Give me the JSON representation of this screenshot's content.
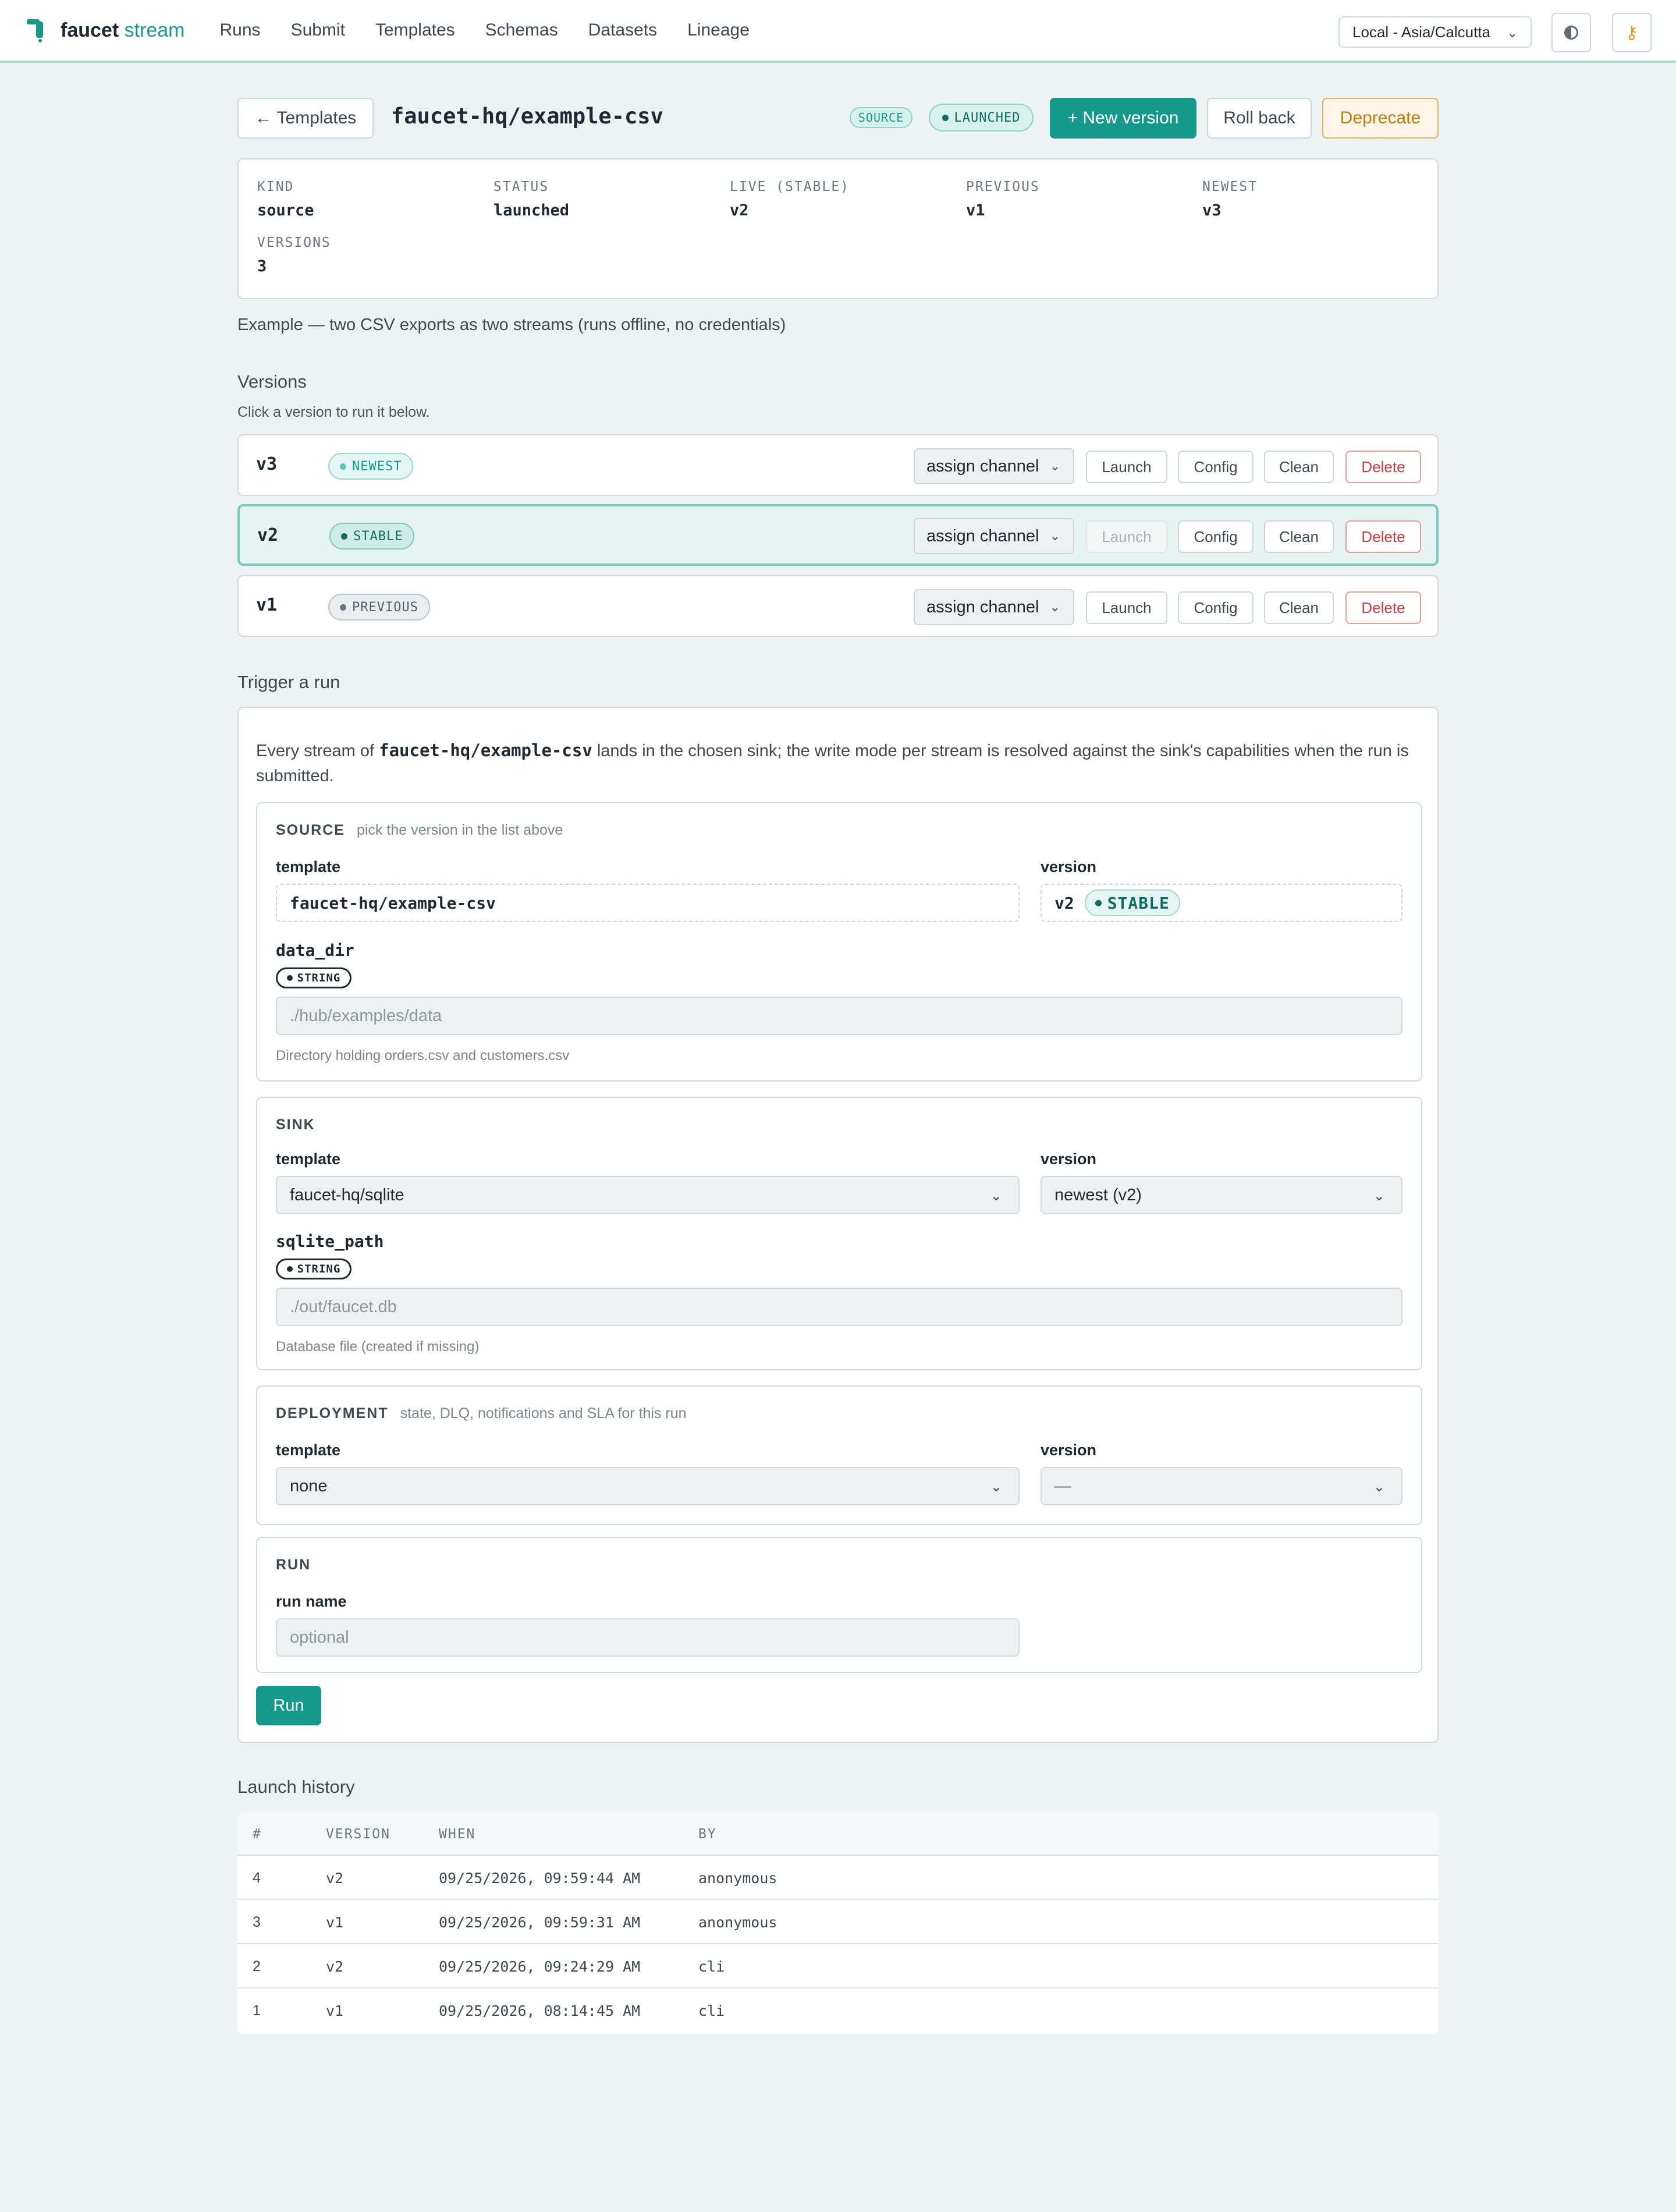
{
  "nav": {
    "brand_main": "faucet",
    "brand_accent": "stream",
    "links": [
      "Runs",
      "Submit",
      "Templates",
      "Schemas",
      "Datasets",
      "Lineage"
    ],
    "timezone": "Local - Asia/Calcutta",
    "theme_icon": "contrast-icon",
    "key_icon": "key-icon"
  },
  "header": {
    "back_label": "← Templates",
    "title": "faucet-hq/example-csv",
    "kind_tag": "SOURCE",
    "status_tag": "LAUNCHED",
    "new_version": "+ New version",
    "roll_back": "Roll back",
    "deprecate": "Deprecate"
  },
  "summary": {
    "stats": [
      {
        "label": "KIND",
        "value": "source"
      },
      {
        "label": "STATUS",
        "value": "launched"
      },
      {
        "label": "LIVE (STABLE)",
        "value": "v2"
      },
      {
        "label": "PREVIOUS",
        "value": "v1"
      },
      {
        "label": "NEWEST",
        "value": "v3"
      },
      {
        "label": "VERSIONS",
        "value": "3"
      }
    ],
    "description": "Example — two CSV exports as two streams (runs offline, no credentials)"
  },
  "versions": {
    "title": "Versions",
    "subtitle": "Click a version to run it below.",
    "rows": [
      {
        "name": "v3",
        "tag": "NEWEST",
        "channel": "assign channel",
        "launch": "Launch",
        "config": "Config",
        "clean": "Clean",
        "delete": "Delete"
      },
      {
        "name": "v2",
        "tag": "STABLE",
        "channel": "assign channel",
        "launch": "Launch",
        "config": "Config",
        "clean": "Clean",
        "delete": "Delete"
      },
      {
        "name": "v1",
        "tag": "PREVIOUS",
        "channel": "assign channel",
        "launch": "Launch",
        "config": "Config",
        "clean": "Clean",
        "delete": "Delete"
      }
    ]
  },
  "trigger": {
    "title": "Trigger a run",
    "intro_before": "Every stream of ",
    "intro_code": "faucet-hq/example-csv",
    "intro_after": " lands in the chosen sink; the write mode per stream is resolved against the sink's capabilities when the run is submitted.",
    "source": {
      "heading": "SOURCE",
      "hint": "pick the version in the list above",
      "template_label": "template",
      "template_value": "faucet-hq/example-csv",
      "version_label": "version",
      "version_value": "v2",
      "version_tag": "STABLE",
      "field_name": "data_dir",
      "field_type": "STRING",
      "field_placeholder": "./hub/examples/data",
      "field_help": "Directory holding orders.csv and customers.csv"
    },
    "sink": {
      "heading": "SINK",
      "template_label": "template",
      "template_value": "faucet-hq/sqlite",
      "version_label": "version",
      "version_value": "newest (v2)",
      "field_name": "sqlite_path",
      "field_type": "STRING",
      "field_placeholder": "./out/faucet.db",
      "field_help": "Database file (created if missing)"
    },
    "deployment": {
      "heading": "DEPLOYMENT",
      "hint": "state, DLQ, notifications and SLA for this run",
      "template_label": "template",
      "template_value": "none",
      "version_label": "version",
      "version_value": "—"
    },
    "run": {
      "heading": "RUN",
      "name_label": "run name",
      "name_placeholder": "optional",
      "button": "Run"
    }
  },
  "history": {
    "title": "Launch history",
    "columns": [
      "#",
      "VERSION",
      "WHEN",
      "BY"
    ],
    "rows": [
      [
        "4",
        "v2",
        "09/25/2026, 09:59:44 AM",
        "anonymous"
      ],
      [
        "3",
        "v1",
        "09/25/2026, 09:59:31 AM",
        "anonymous"
      ],
      [
        "2",
        "v2",
        "09/25/2026, 09:24:29 AM",
        "cli"
      ],
      [
        "1",
        "v1",
        "09/25/2026, 08:14:45 AM",
        "cli"
      ]
    ]
  },
  "colors": {
    "accent": "#14998a",
    "danger": "#d63a3a",
    "warning": "#c47d0d",
    "background": "#edf2f2"
  }
}
